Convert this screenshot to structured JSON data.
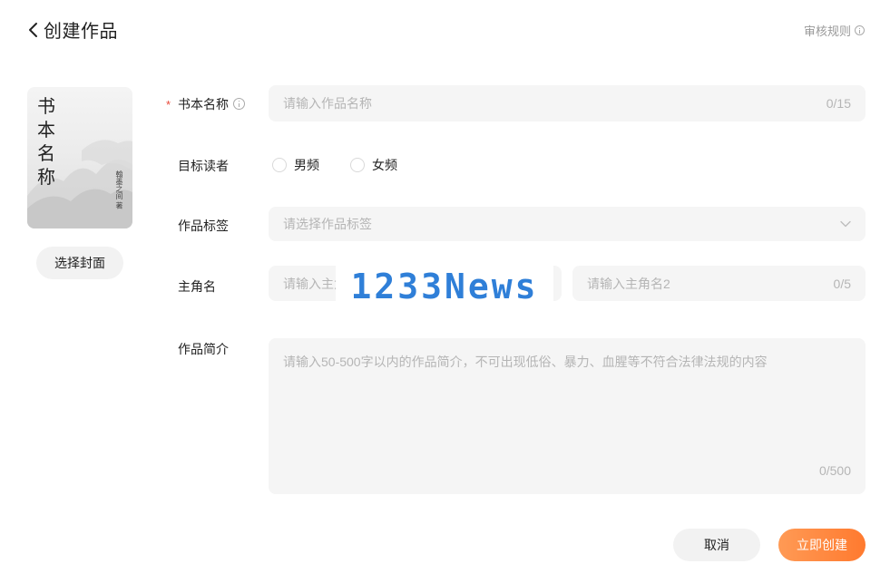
{
  "header": {
    "title": "创建作品",
    "back_icon": "chevron-left-icon"
  },
  "rules_link": {
    "label": "审核规则",
    "icon": "info-icon"
  },
  "cover": {
    "title_text": "书本名称",
    "side_text": "翰墨之间 著",
    "select_button": "选择封面"
  },
  "form": {
    "book_name": {
      "label": "书本名称",
      "placeholder": "请输入作品名称",
      "counter": "0/15",
      "required_mark": "*"
    },
    "target_reader": {
      "label": "目标读者",
      "options": [
        "男频",
        "女频"
      ]
    },
    "tags": {
      "label": "作品标签",
      "placeholder": "请选择作品标签"
    },
    "protagonist": {
      "label": "主角名",
      "placeholder_1": "请输入主角名1",
      "placeholder_2": "请输入主角名2",
      "counter_2": "0/5"
    },
    "synopsis": {
      "label": "作品简介",
      "placeholder": "请输入50-500字以内的作品简介，不可出现低俗、暴力、血腥等不符合法律法规的内容",
      "counter": "0/500"
    }
  },
  "watermark": "1233News",
  "actions": {
    "cancel": "取消",
    "create": "立即创建"
  },
  "colors": {
    "accent": "#ff7a2f",
    "required": "#e8483a",
    "field_bg": "#f5f5f5",
    "watermark": "#2f7fd8"
  }
}
